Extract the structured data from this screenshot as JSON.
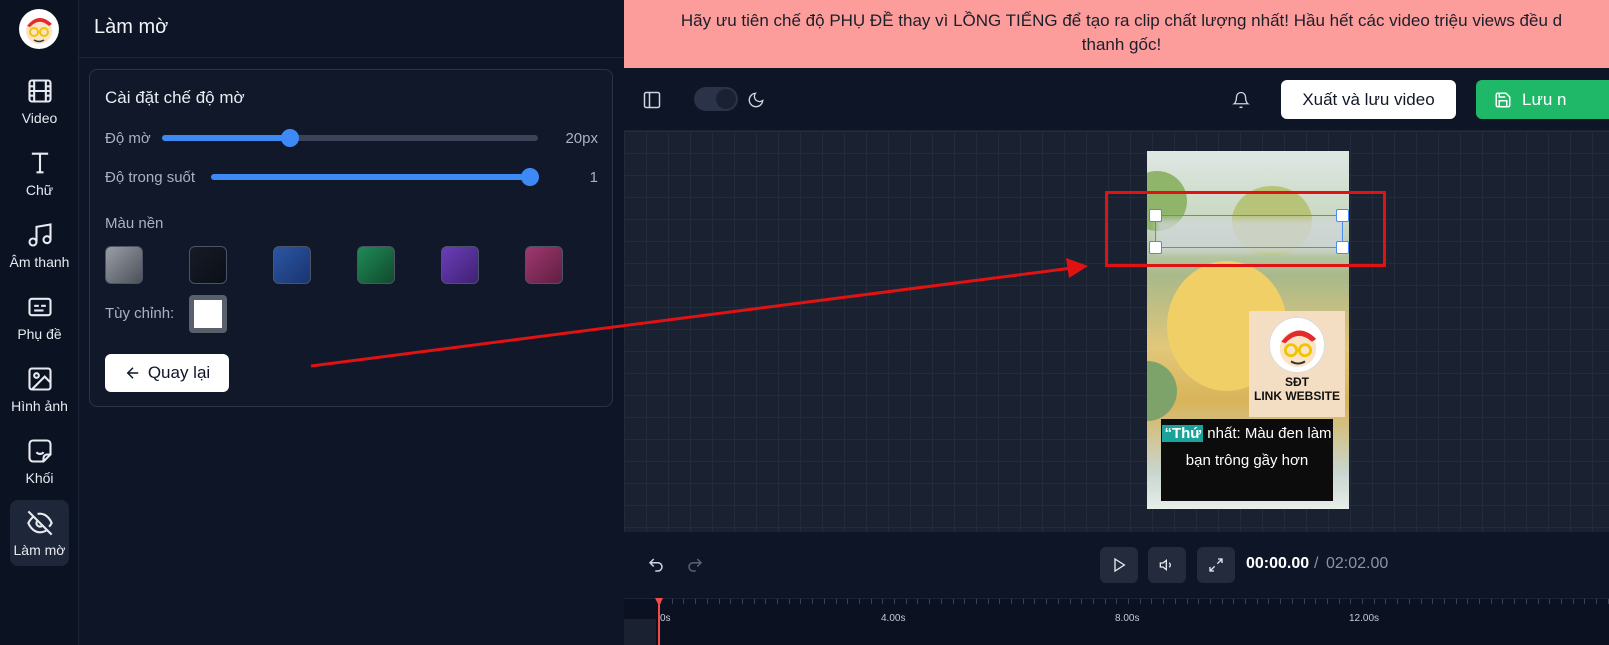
{
  "rail": {
    "items": [
      {
        "label": "Video",
        "icon": "film-icon"
      },
      {
        "label": "Chữ",
        "icon": "text-icon"
      },
      {
        "label": "Âm thanh",
        "icon": "music-icon"
      },
      {
        "label": "Phụ đề",
        "icon": "subtitles-icon"
      },
      {
        "label": "Hình ảnh",
        "icon": "image-icon"
      },
      {
        "label": "Khối",
        "icon": "sticker-icon"
      },
      {
        "label": "Làm mờ",
        "icon": "eye-off-icon",
        "active": true
      }
    ]
  },
  "panel": {
    "title": "Làm mờ",
    "card_title": "Cài đặt chế độ mờ",
    "blur": {
      "label": "Độ mờ",
      "value_text": "20px",
      "fraction": 0.34
    },
    "opacity": {
      "label": "Độ trong suốt",
      "value_text": "1",
      "fraction": 1.0
    },
    "bg_label": "Màu nền",
    "swatches": [
      {
        "name": "gray",
        "from": "#9a9ea6",
        "to": "#4b4f57"
      },
      {
        "name": "black",
        "from": "#161b26",
        "to": "#0b0f17"
      },
      {
        "name": "blue",
        "from": "#2b56a3",
        "to": "#1a3470"
      },
      {
        "name": "green",
        "from": "#1f8a55",
        "to": "#114a2e"
      },
      {
        "name": "purple",
        "from": "#6b3db8",
        "to": "#3e2273"
      },
      {
        "name": "pink",
        "from": "#a0386e",
        "to": "#5f1e42"
      }
    ],
    "custom_label": "Tùy chỉnh:",
    "custom_color": "#ffffff",
    "back_label": "Quay lại"
  },
  "banner": {
    "line1": "Hãy ưu tiên chế độ PHỤ ĐỀ thay vì LỒNG TIẾNG để tạo ra clip chất lượng nhất! Hầu hết các video triệu views đều d",
    "line2": "thanh gốc!"
  },
  "toolbar": {
    "export_label": "Xuất và lưu video",
    "save_label": "Lưu n"
  },
  "video": {
    "logo_line1": "SĐT",
    "logo_line2": "LINK WEBSITE",
    "subtitle_highlight": "“Thứ",
    "subtitle_rest": " nhất: Màu đen làm bạn trông gầy hơn"
  },
  "controls": {
    "current_time": "00:00.00",
    "separator": "/",
    "total_time": "02:02.00"
  },
  "timeline": {
    "ticks": [
      "0s",
      "4.00s",
      "8.00s",
      "12.00s"
    ]
  },
  "colors": {
    "accent": "#3d8af7",
    "save_green": "#1fb868",
    "banner_bg": "#fc9d9b",
    "annotation_red": "#e01212"
  }
}
